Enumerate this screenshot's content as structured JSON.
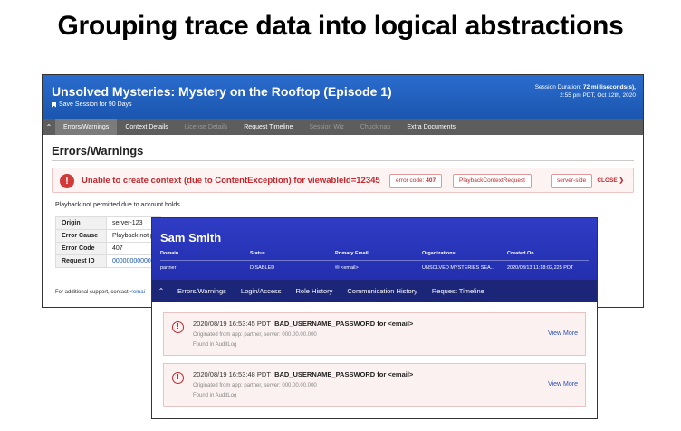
{
  "slide_title": "Grouping trace data into logical abstractions",
  "session_window": {
    "title": "Unsolved Mysteries: Mystery on the Rooftop (Episode 1)",
    "save_label": "Save Session for 90 Days",
    "session_duration_label": "Session Duration:",
    "session_duration_value": "72 milliseconds(s),",
    "session_time": "2:55 pm PDT, Oct 12th, 2020",
    "tabs": [
      {
        "label": "Errors/Warnings",
        "state": "active"
      },
      {
        "label": "Context Details",
        "state": "normal"
      },
      {
        "label": "License Details",
        "state": "disabled"
      },
      {
        "label": "Request Timeline",
        "state": "normal"
      },
      {
        "label": "Session Wiz",
        "state": "disabled"
      },
      {
        "label": "Chuckmap",
        "state": "disabled"
      },
      {
        "label": "Extra Documents",
        "state": "normal"
      }
    ],
    "section_title": "Errors/Warnings",
    "alert": {
      "message": "Unable to create context (due to ContentException) for viewableId=12345",
      "error_code_label": "error code:",
      "error_code_value": "407",
      "tag_1": "PlaybackContextRequest",
      "tag_2": "server-side",
      "close_label": "CLOSE"
    },
    "description": "Playback not permitted due to account holds.",
    "details": [
      {
        "key": "Origin",
        "value": "server-123"
      },
      {
        "key": "Error Cause",
        "value": "Playback not p"
      },
      {
        "key": "Error Code",
        "value": "407"
      },
      {
        "key": "Request ID",
        "value": "000000000000"
      }
    ],
    "footer_text": "For additional support, contact",
    "footer_link": "<emai"
  },
  "user_window": {
    "name": "Sam Smith",
    "columns": [
      {
        "label": "Domain",
        "value": "partner"
      },
      {
        "label": "Status",
        "value": "DISABLED"
      },
      {
        "label": "Primary Email",
        "value": "<email>"
      },
      {
        "label": "Organizations",
        "value": "UNSOLVED MYSTERIES SEA..."
      },
      {
        "label": "Created On",
        "value": "2020/03/13 11:18:02,225 PDT"
      }
    ],
    "tabs": [
      "Errors/Warnings",
      "Login/Access",
      "Role History",
      "Communication History",
      "Request Timeline"
    ],
    "events": [
      {
        "timestamp": "2020/08/19 16:53:45 PDT",
        "code": "BAD_USERNAME_PASSWORD for <email>",
        "origin": "Originated from app: partner, server: 000.00.00.000",
        "found_in": "Found in AuditLog",
        "action": "View More"
      },
      {
        "timestamp": "2020/08/19 16:53:48 PDT",
        "code": "BAD_USERNAME_PASSWORD for <email>",
        "origin": "Originated from app: partner, server: 000.00.00.000",
        "found_in": "Found in AuditLog",
        "action": "View More"
      }
    ]
  },
  "icons": {
    "bookmark": "bookmark-icon",
    "chevron": "chevron-up-icon",
    "alert": "exclamation-circle-icon",
    "close": "chevron-down-icon",
    "email": "envelope-icon"
  },
  "colors": {
    "session_header": "#1e5fbf",
    "user_header": "#2a36bd",
    "user_tabs": "#1b2678",
    "error_red": "#c0282d"
  }
}
